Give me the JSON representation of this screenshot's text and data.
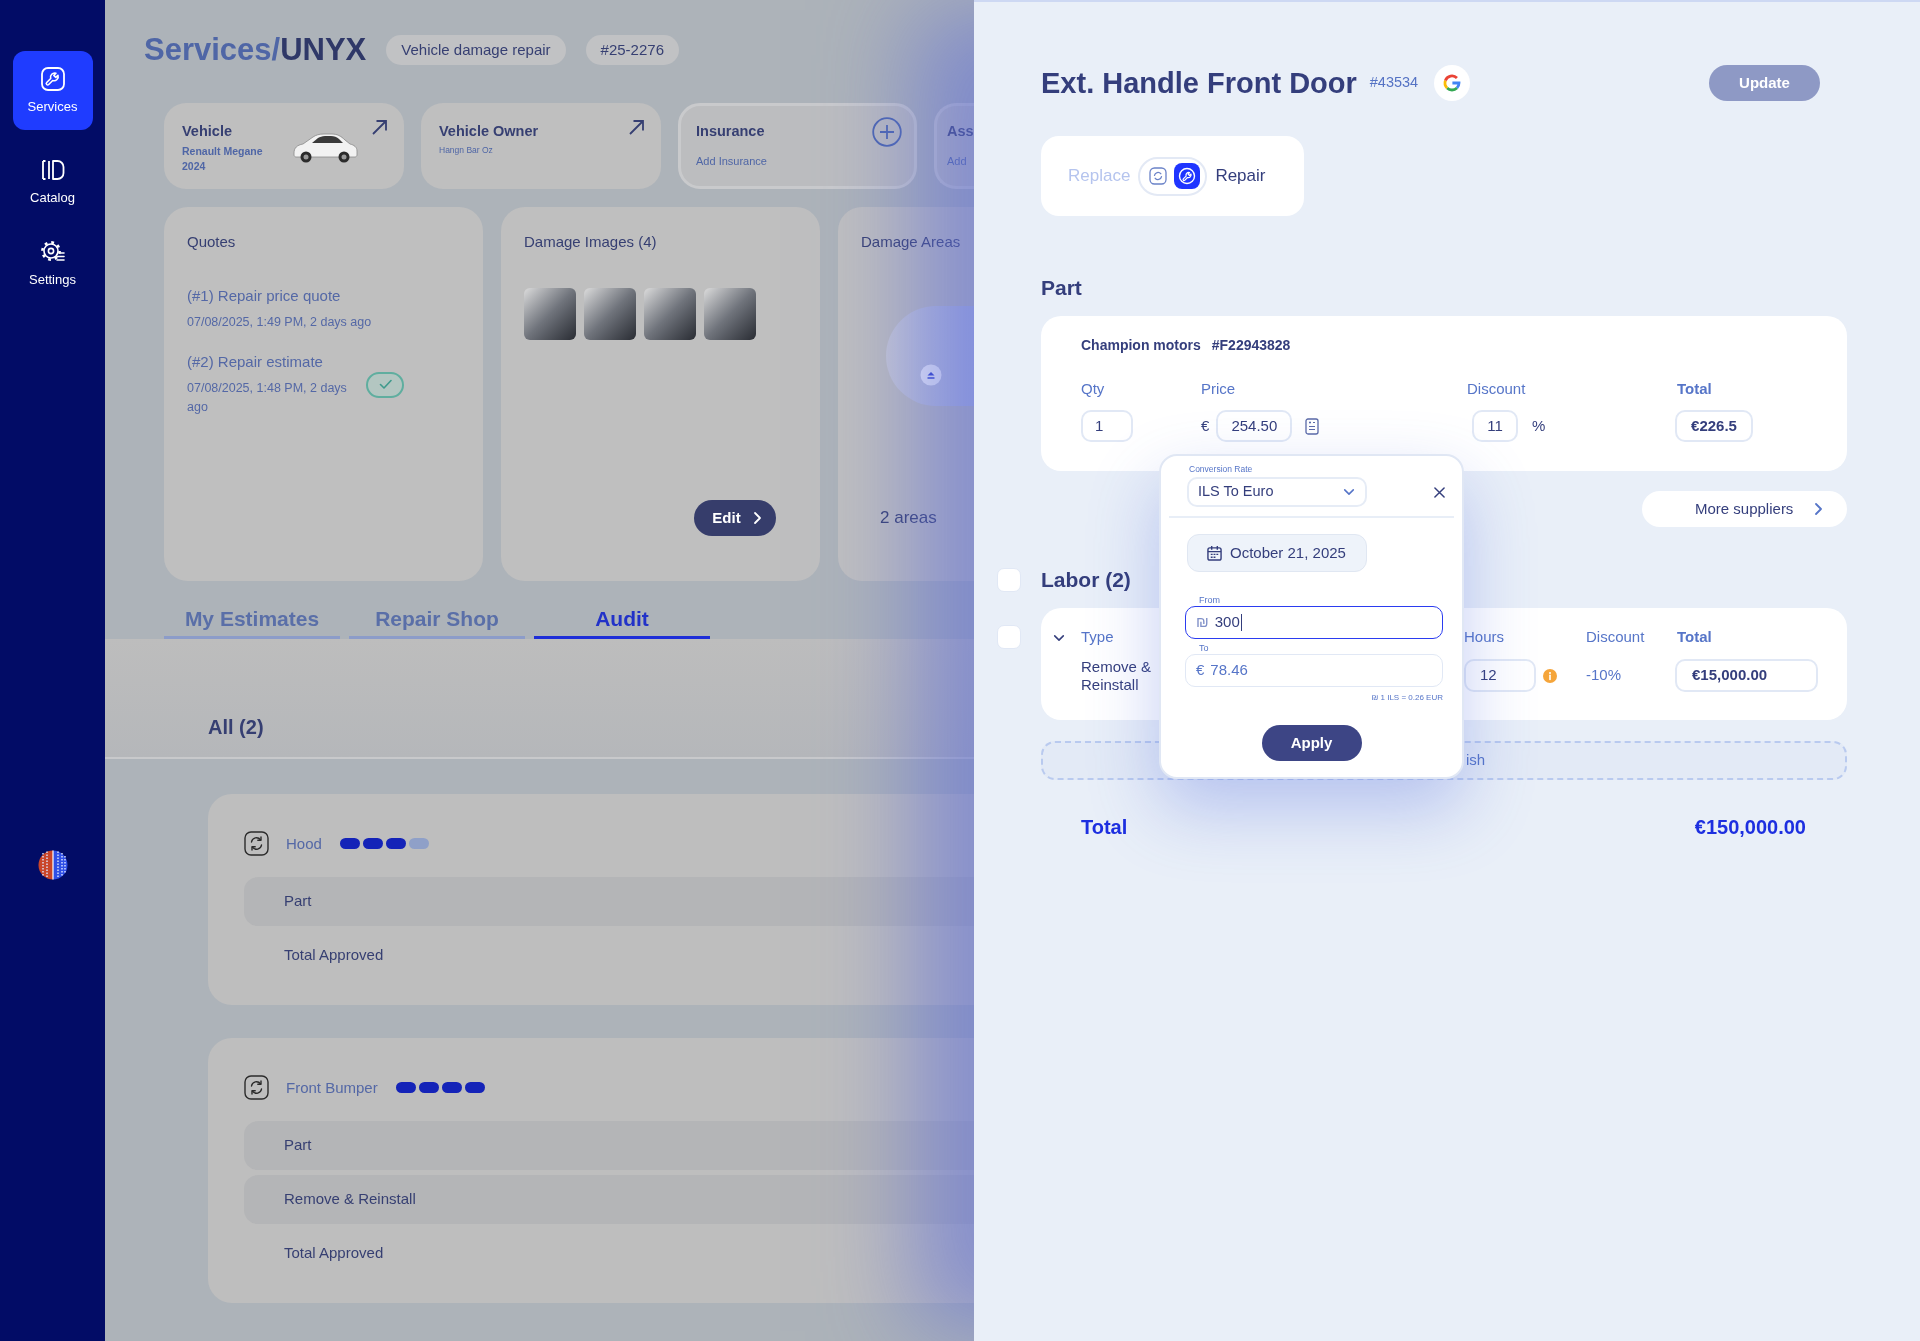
{
  "sidebar": {
    "items": [
      {
        "label": "Services",
        "selected": true
      },
      {
        "label": "Catalog",
        "selected": false
      },
      {
        "label": "Settings",
        "selected": false
      }
    ]
  },
  "header": {
    "path": "Services/",
    "title": "UNYX",
    "tags": [
      "Vehicle damage repair",
      "#25-2276"
    ]
  },
  "info_cards": [
    {
      "kind": "vehicle",
      "title": "Vehicle",
      "lines": [
        "Renault Megane",
        "2024"
      ]
    },
    {
      "kind": "link",
      "title": "Vehicle Owner",
      "lines": [
        "Hangn Bar Oz"
      ]
    },
    {
      "kind": "add",
      "title": "Insurance",
      "lines": [
        "Add Insurance"
      ]
    },
    {
      "kind": "outlined",
      "title": "Ass",
      "lines": [
        "Add"
      ]
    }
  ],
  "quotes": {
    "title": "Quotes",
    "items": [
      {
        "title": "(#1) Repair price quote",
        "date": "07/08/2025, 1:49 PM, 2 days ago",
        "approved": false
      },
      {
        "title": "(#2) Repair estimate",
        "date": "07/08/2025, 1:48 PM, 2 days ago",
        "approved": true
      }
    ]
  },
  "damage_images": {
    "title": "Damage Images (4)",
    "images": [
      {
        "kind": "photo"
      },
      {
        "kind": "photo"
      },
      {
        "kind": "photo"
      },
      {
        "kind": "photo"
      }
    ],
    "button": "Edit"
  },
  "damage_areas": {
    "title": "Damage Areas",
    "summary": "2 areas"
  },
  "tabs": [
    {
      "label": "My Estimates",
      "selected": false
    },
    {
      "label": "Repair Shop",
      "selected": false
    },
    {
      "label": "Audit",
      "selected": true
    }
  ],
  "audit": {
    "filter": "All (2)",
    "groups": [
      {
        "name": "Hood",
        "stars": 3,
        "rows": [
          {
            "kind": "item",
            "label": "Part"
          },
          {
            "kind": "total",
            "label": "Total Approved"
          }
        ]
      },
      {
        "name": "Front Bumper",
        "stars": 4,
        "rows": [
          {
            "kind": "item",
            "label": "Part"
          },
          {
            "kind": "item",
            "label": "Remove & Reinstall"
          },
          {
            "kind": "total",
            "label": "Total Approved"
          }
        ]
      }
    ]
  },
  "drawer": {
    "title": "Ext. Handle Front Door",
    "code": "#43534",
    "update": {
      "label": "Update",
      "disabled": true
    },
    "mode_options": [
      {
        "label": "Replace",
        "selected": false
      },
      {
        "label": "Repair",
        "selected": true
      }
    ],
    "part": {
      "heading": "Part",
      "supplier": "Champion motors",
      "supplier_code": "#F22943828",
      "columns": [
        "Qty",
        "Price",
        "Discount",
        "Total"
      ],
      "qty": "1",
      "currency": "€",
      "price": "254.50",
      "discount": "11",
      "discount_unit": "%",
      "total": "€226.5"
    },
    "more_suppliers": "More suppliers",
    "labor": {
      "heading": "Labor (2)",
      "checked": false,
      "rows": [
        {
          "checked": false,
          "expanded": true,
          "type_label": "Type",
          "type": "Remove & Reinstall",
          "hours_label": "Hours",
          "hours": "12",
          "warning": true,
          "discount_label": "Discount",
          "discount": "-10%",
          "total_label": "Total",
          "total": "€15,000.00"
        }
      ]
    },
    "add_row": "ish",
    "total": {
      "label": "Total",
      "value": "€150,000.00"
    },
    "popup": {
      "rate_label": "Conversion Rate",
      "rate": "ILS To Euro",
      "date": "October 21, 2025",
      "fields": [
        {
          "label": "From",
          "symbol": "₪",
          "value": "300",
          "focused": true
        },
        {
          "label": "To",
          "symbol": "€",
          "value": "78.46",
          "focused": false
        }
      ],
      "note": "₪ 1 ILS = 0.26 EUR",
      "apply": "Apply"
    }
  }
}
